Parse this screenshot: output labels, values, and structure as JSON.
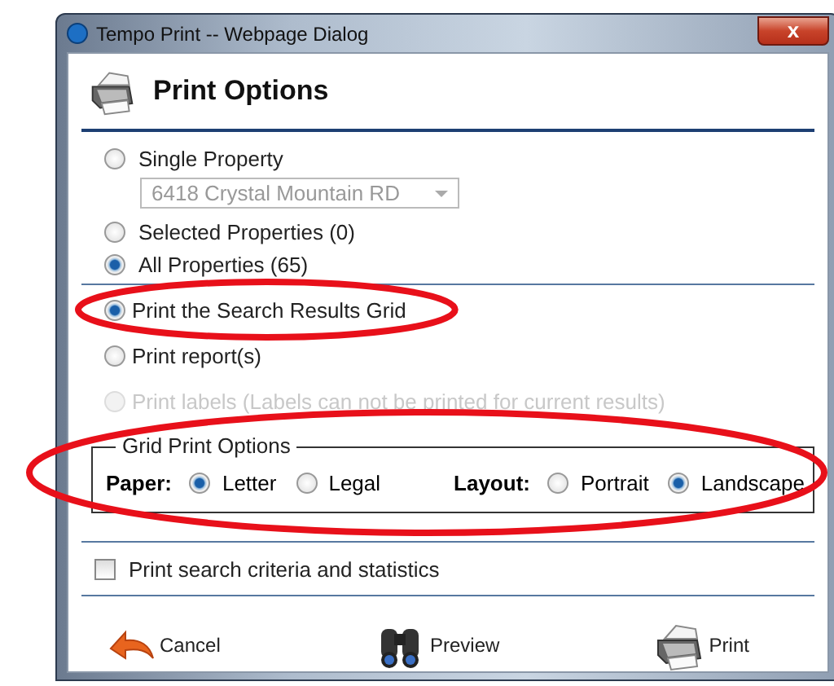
{
  "window": {
    "title": "Tempo Print -- Webpage Dialog",
    "close": "x"
  },
  "header": {
    "title": "Print Options"
  },
  "scope": [
    {
      "label": "Single Property",
      "selected": false,
      "disabled": false
    },
    {
      "label": "Selected Properties (0)",
      "selected": false,
      "disabled": false
    },
    {
      "label": "All Properties (65)",
      "selected": true,
      "disabled": false
    }
  ],
  "property_dropdown": {
    "value": "6418 Crystal Mountain RD",
    "disabled": true
  },
  "print_modes": [
    {
      "label": "Print the Search Results Grid",
      "selected": true,
      "disabled": false
    },
    {
      "label": "Print report(s)",
      "selected": false,
      "disabled": false
    },
    {
      "label": "Print labels (Labels can not be printed for current results)",
      "selected": false,
      "disabled": true
    }
  ],
  "grid_options": {
    "legend": "Grid Print Options",
    "groups": [
      {
        "label": "Paper:",
        "options": [
          {
            "label": "Letter",
            "selected": true
          },
          {
            "label": "Legal",
            "selected": false
          }
        ]
      },
      {
        "label": "Layout:",
        "options": [
          {
            "label": "Portrait",
            "selected": false
          },
          {
            "label": "Landscape",
            "selected": true
          }
        ]
      }
    ]
  },
  "criteria_checkbox": {
    "label": "Print search criteria and statistics",
    "checked": false
  },
  "buttons": [
    {
      "kind": "cancel",
      "label": "Cancel"
    },
    {
      "kind": "preview",
      "label": "Preview"
    },
    {
      "kind": "print",
      "label": "Print"
    }
  ]
}
